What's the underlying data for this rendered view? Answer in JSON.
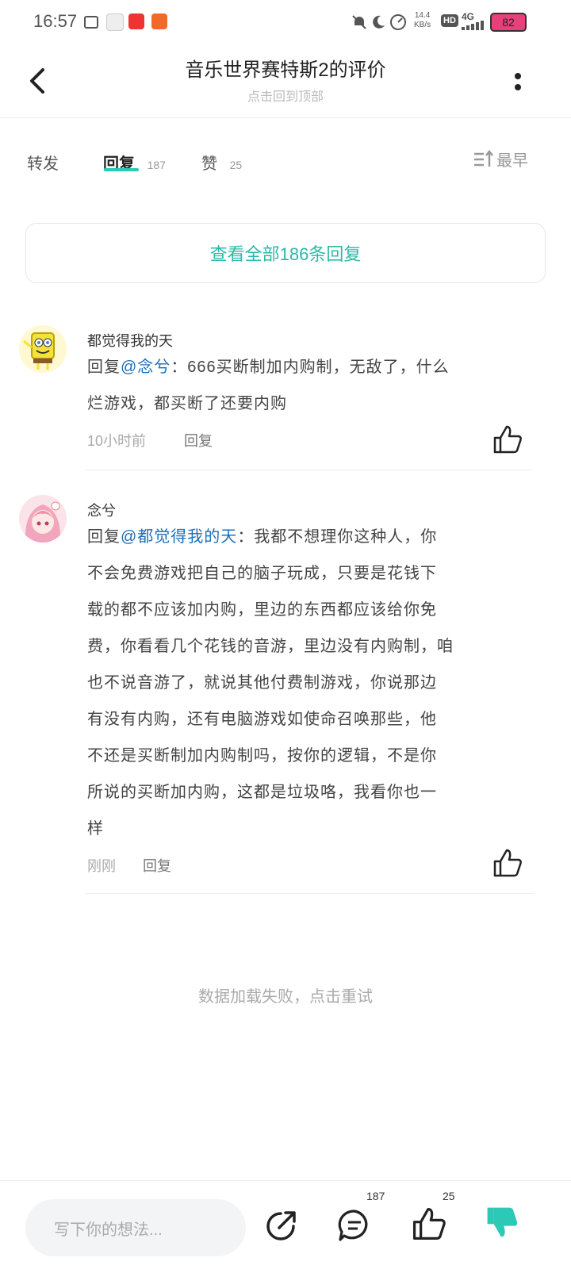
{
  "status": {
    "time": "16:57",
    "speed_value": "14.4",
    "speed_unit": "KB/s",
    "hd": "HD",
    "net": "4G",
    "battery": "82"
  },
  "header": {
    "title": "音乐世界赛特斯2的评价",
    "subtitle": "点击回到顶部"
  },
  "tabs": [
    {
      "label": "转发",
      "count": ""
    },
    {
      "label": "回复",
      "count": "187"
    },
    {
      "label": "赞",
      "count": "25"
    }
  ],
  "sort": {
    "label": "最早"
  },
  "view_all": {
    "label": "查看全部186条回复"
  },
  "comments": [
    {
      "user": "都觉得我的天",
      "reply_prefix": "回复",
      "mention": "@念兮",
      "text_line1": "：666买断制加内购制，无敌了，什么",
      "text_line2": "烂游戏，都买断了还要内购",
      "time": "10小时前",
      "reply_label": "回复"
    },
    {
      "user": "念兮",
      "reply_prefix": "回复",
      "mention": "@都觉得我的天",
      "lines": [
        "：我都不想理你这种人，你",
        "不会免费游戏把自己的脑子玩成，只要是花钱下",
        "载的都不应该加内购，里边的东西都应该给你免",
        "费，你看看几个花钱的音游，里边没有内购制，咱",
        "也不说音游了，就说其他付费制游戏，你说那边",
        "有没有内购，还有电脑游戏如使命召唤那些，他",
        "不还是买断制加内购制吗，按你的逻辑，不是你",
        "所说的买断加内购，这都是垃圾咯，我看你也一",
        "样"
      ],
      "time": "刚刚",
      "reply_label": "回复"
    }
  ],
  "retry": {
    "label": "数据加载失败，点击重试"
  },
  "bottom": {
    "placeholder": "写下你的想法...",
    "comment_count": "187",
    "like_count": "25"
  },
  "colors": {
    "accent": "#2bc9b6",
    "mention": "#1a6fb8",
    "battery": "#e8407a"
  }
}
